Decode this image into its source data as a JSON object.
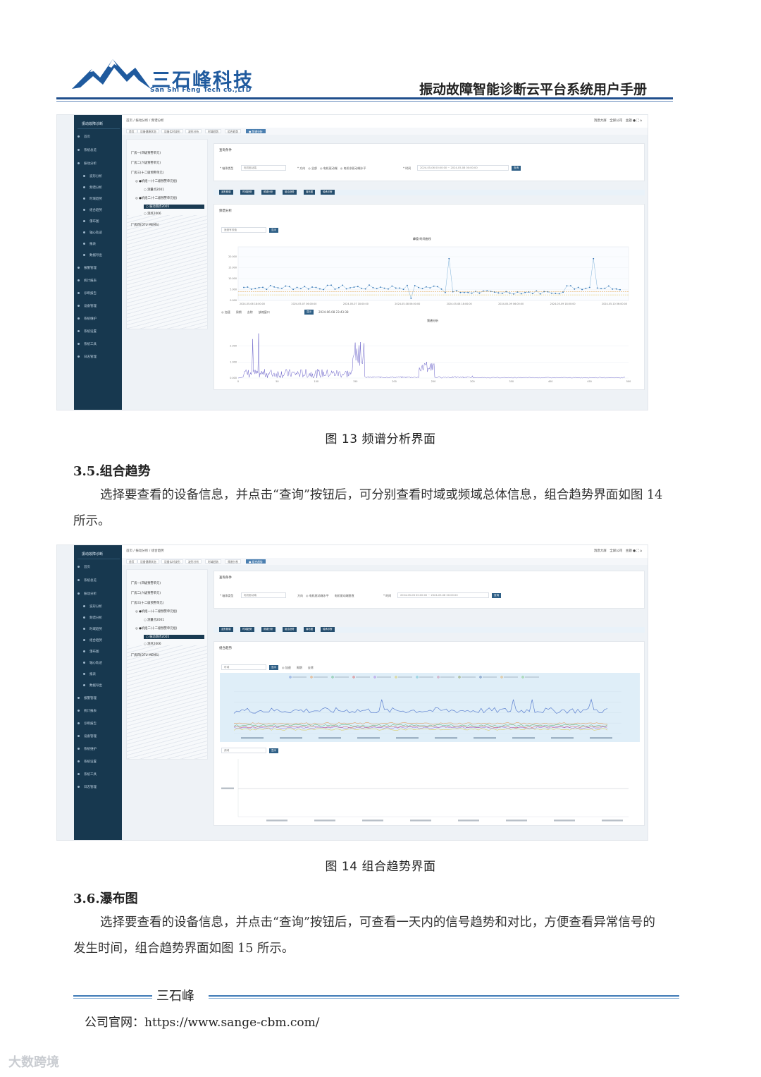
{
  "header": {
    "logo_cn": "三石峰科技",
    "logo_en": "San Shi Feng Tech co.,LTD",
    "manual_title": "振动故障智能诊断云平台系统用户手册"
  },
  "fig13": {
    "caption": "图 13 频谱分析界面",
    "chart_top_title": "峰值-时间曲线",
    "chart_bottom_title": "频谱分析",
    "timestamp": "2024-06-08 23:43:38",
    "query_title": "查询条件",
    "panel_title": "频谱分析"
  },
  "sec35": {
    "heading": "3.5.组合趋势",
    "text": "选择要查看的设备信息，并点击“查询”按钮后，可分别查看时域或频域总体信息，组合趋势界面如图 14 所示。"
  },
  "fig14": {
    "caption": "图 14 组合趋势界面",
    "query_title": "查询条件",
    "panel_title": "组合趋势"
  },
  "sec36": {
    "heading": "3.6.瀑布图",
    "text": "选择要查看的设备信息，并点击“查询”按钮后，可查看一天内的信号趋势和对比，方便查看异常信号的发生时间，组合趋势界面如图 15 所示。"
  },
  "footer": {
    "brand": "三石峰",
    "site": "公司官网：https://www.sange-cbm.com/"
  },
  "watermark": "大数跨境",
  "chart_data": [
    {
      "type": "line",
      "title": "峰值-时间曲线",
      "x": [
        "2024-05-06 18:00:00",
        "2024-05-07 06:00:00",
        "2024-05-07 18:00:00",
        "2024-05-08 06:00:00",
        "2024-05-08 18:00:00",
        "2024-05-09 06:00:00",
        "2024-05-09 18:00:00",
        "2024-05-10 06:00:00"
      ],
      "y_ticks": [
        "0.000",
        "5.000",
        "10.000",
        "15.000",
        "20.000"
      ],
      "ylim": [
        0,
        25
      ]
    },
    {
      "type": "line",
      "title": "频谱分析",
      "x_ticks": [
        "0",
        "50",
        "100",
        "150",
        "200",
        "250",
        "300",
        "350",
        "400",
        "450",
        "500"
      ],
      "y_ticks": [
        "0.000",
        "1.000",
        "2.000"
      ],
      "ylim": [
        0,
        3
      ]
    }
  ]
}
